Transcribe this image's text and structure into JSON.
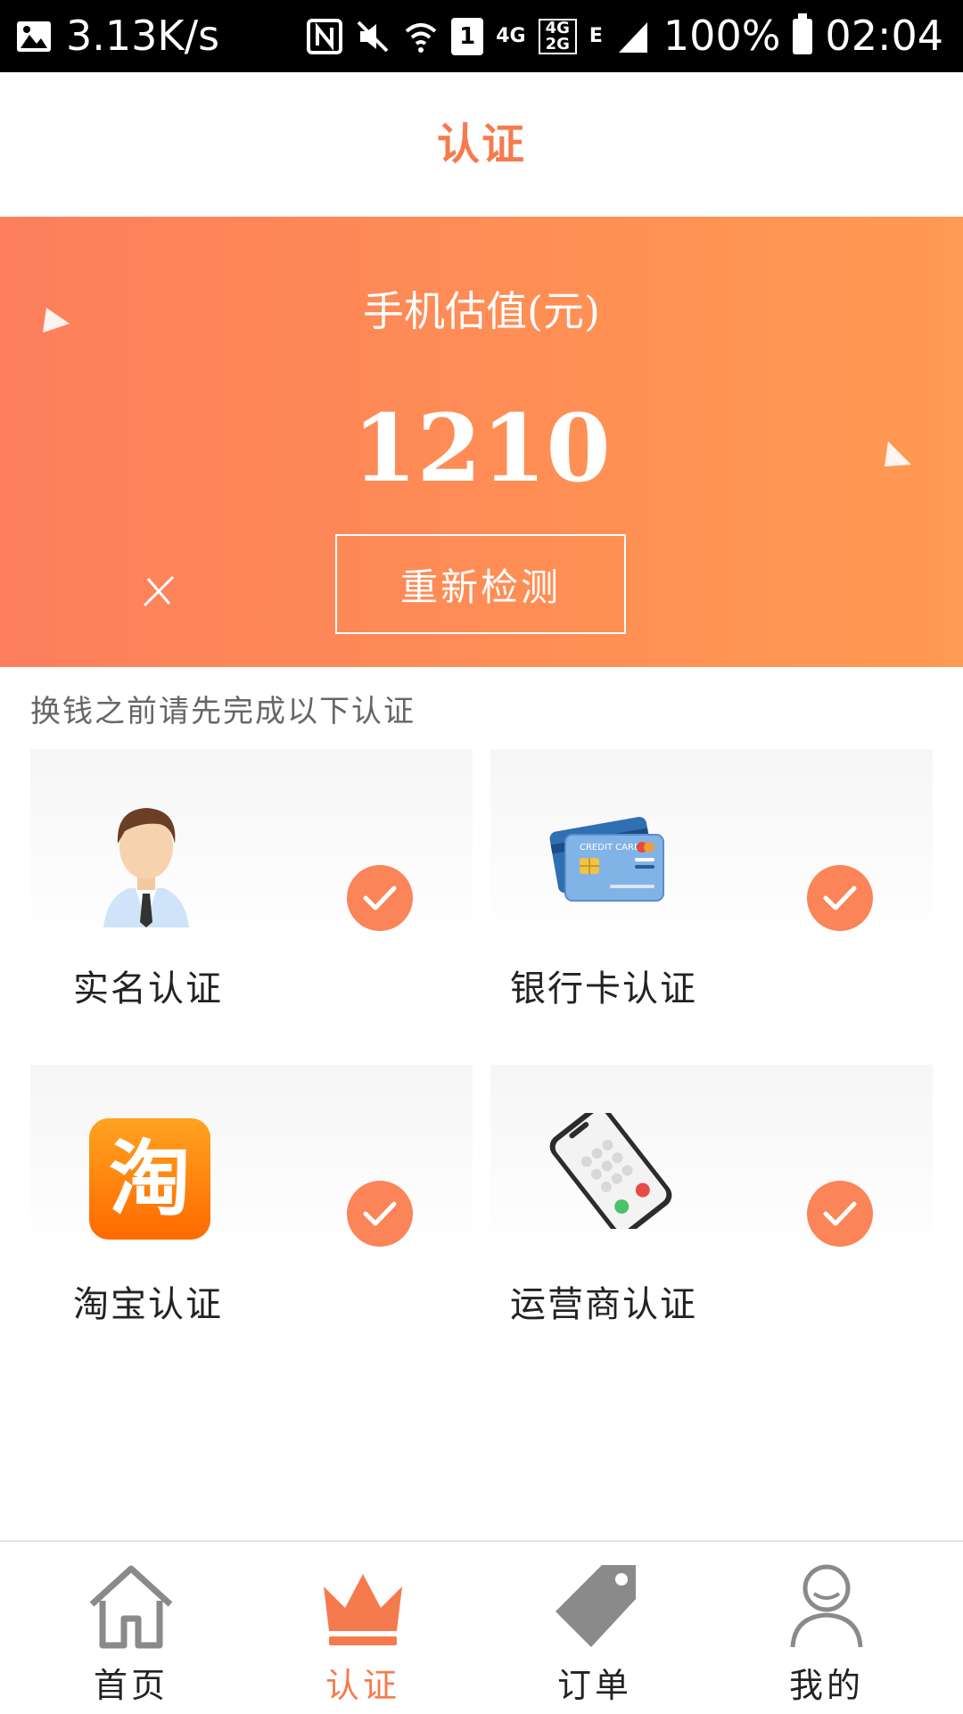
{
  "status_bar": {
    "speed": "3.13K/s",
    "network_4g": "4G",
    "network_4g2g_top": "4G",
    "network_4g2g_bottom": "2G",
    "network_e": "E",
    "sim_number": "1",
    "battery": "100%",
    "time": "02:04"
  },
  "header": {
    "title": "认证"
  },
  "banner": {
    "label": "手机估值(元)",
    "value": "1210",
    "recheck_label": "重新检测"
  },
  "section": {
    "hint": "换钱之前请先完成以下认证"
  },
  "cards": [
    {
      "label": "实名认证",
      "icon": "person-avatar-icon",
      "verified": true
    },
    {
      "label": "银行卡认证",
      "icon": "credit-card-icon",
      "verified": true,
      "card_text": "CREDIT CARD"
    },
    {
      "label": "淘宝认证",
      "icon": "taobao-logo-icon",
      "verified": true,
      "logo_text": "淘"
    },
    {
      "label": "运营商认证",
      "icon": "smartphone-icon",
      "verified": true
    }
  ],
  "nav": [
    {
      "label": "首页",
      "icon": "home-icon",
      "active": false
    },
    {
      "label": "认证",
      "icon": "crown-icon",
      "active": true
    },
    {
      "label": "订单",
      "icon": "tag-icon",
      "active": false
    },
    {
      "label": "我的",
      "icon": "user-icon",
      "active": false
    }
  ],
  "colors": {
    "accent": "#f57b4f",
    "banner_start": "#fd7f5c",
    "banner_end": "#ff9a52",
    "check": "#fb8458",
    "nav_inactive": "#8a8a8a"
  }
}
